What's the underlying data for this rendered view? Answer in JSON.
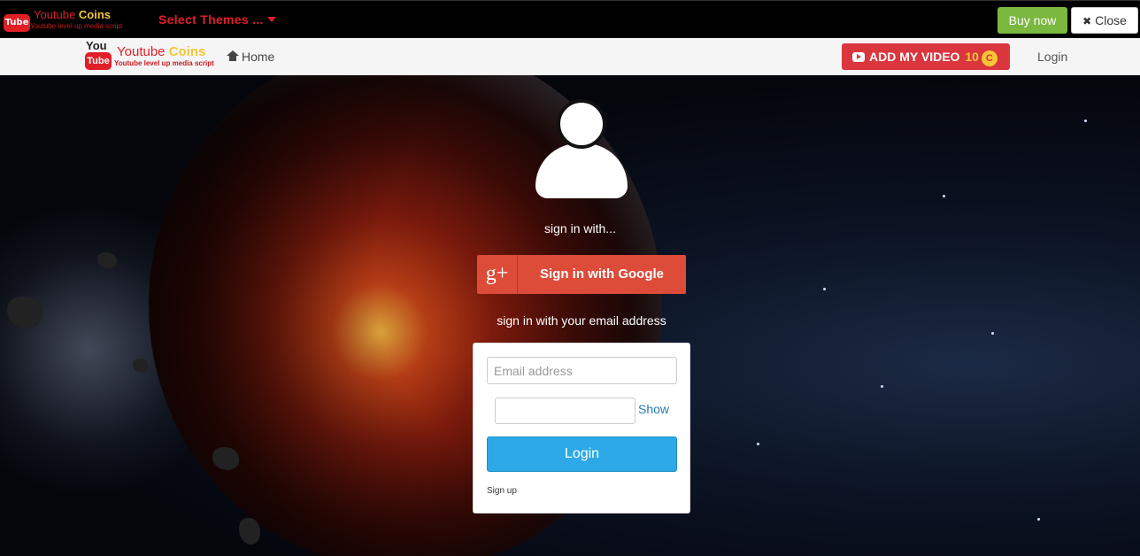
{
  "topbar": {
    "logo": {
      "line1_a": "Youtube",
      "line1_b": "Coins",
      "line2": "Youtube level up media script",
      "badge": "Tube"
    },
    "select_themes": "Select Themes ...",
    "buy_now": "Buy now",
    "close": "Close"
  },
  "navbar": {
    "logo": {
      "you": "You",
      "tube": "Tube",
      "line1_a": "Youtube",
      "line1_b": "Coins",
      "line2": "Youtube level up media script"
    },
    "home": "Home",
    "add_video": "ADD MY VIDEO",
    "coin_count": "10",
    "coin_symbol": "C",
    "login": "Login"
  },
  "signin": {
    "sign_in_with": "sign in with...",
    "google_button": "Sign in with Google",
    "google_glyph": "g+",
    "email_hint": "sign in with your email address",
    "email_placeholder": "Email address",
    "password_value": "",
    "show": "Show",
    "login_button": "Login",
    "sign_up": "Sign up"
  },
  "colors": {
    "brand_red": "#e01f26",
    "brand_gold": "#f6c636",
    "buy_green": "#7ab83f",
    "google_red": "#dd4b39",
    "login_blue": "#2da9e8"
  },
  "icons": [
    "tube-logo-icon",
    "caret-down-icon",
    "close-x-icon",
    "home-icon",
    "play-icon",
    "coin-icon",
    "user-avatar-icon",
    "google-plus-icon"
  ]
}
